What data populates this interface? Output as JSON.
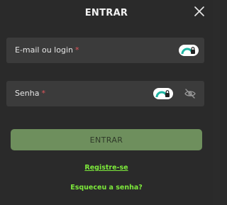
{
  "modal": {
    "title": "ENTRAR",
    "close_icon": "close-icon"
  },
  "form": {
    "email": {
      "label": "E-mail ou login",
      "required_mark": "*",
      "value": "",
      "badge_icon": "password-manager-icon"
    },
    "password": {
      "label": "Senha",
      "required_mark": "*",
      "value": "",
      "badge_icon": "password-manager-icon",
      "toggle_icon": "eye-off-icon"
    },
    "submit_label": "ENTRAR"
  },
  "links": {
    "register": "Registre-se",
    "forgot": "Esqueceu a senha?"
  },
  "colors": {
    "background": "#2a2a2a",
    "field": "#3b3b3b",
    "button": "#6e8f5d",
    "link": "#7dea3b",
    "required": "#e0565b",
    "badge_accent": "#1fb5a3"
  }
}
